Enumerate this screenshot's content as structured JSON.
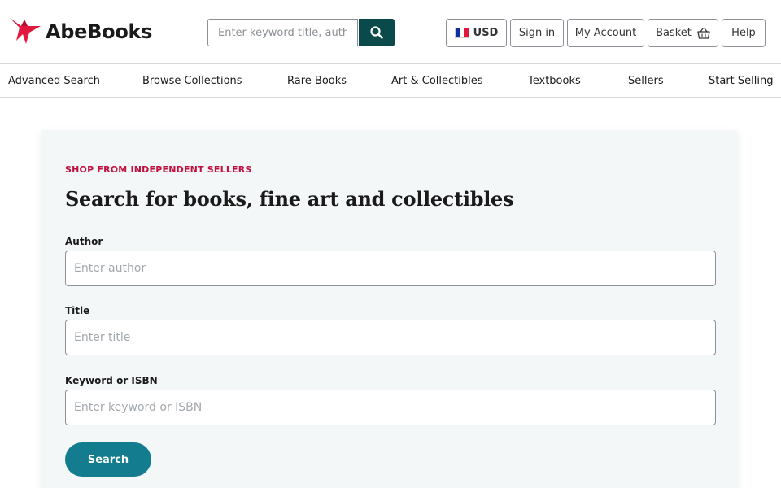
{
  "brand": {
    "name": "AbeBooks",
    "accent": "#e2173d"
  },
  "header": {
    "search_placeholder": "Enter keyword title, author",
    "search_icon": "search-icon",
    "currency": "USD",
    "currency_flag": "france-flag",
    "sign_in": "Sign in",
    "my_account": "My Account",
    "basket": "Basket",
    "basket_icon": "basket-icon",
    "help": "Help"
  },
  "nav": {
    "items": [
      {
        "label": "Advanced Search"
      },
      {
        "label": "Browse Collections"
      },
      {
        "label": "Rare Books"
      },
      {
        "label": "Art & Collectibles"
      },
      {
        "label": "Textbooks"
      },
      {
        "label": "Sellers"
      },
      {
        "label": "Start Selling"
      }
    ]
  },
  "main": {
    "eyebrow": "SHOP FROM INDEPENDENT SELLERS",
    "heading": "Search for books, fine art and collectibles",
    "fields": [
      {
        "label": "Author",
        "placeholder": "Enter author"
      },
      {
        "label": "Title",
        "placeholder": "Enter title"
      },
      {
        "label": "Keyword or ISBN",
        "placeholder": "Enter keyword or ISBN"
      }
    ],
    "submit_label": "Search"
  },
  "colors": {
    "search_button": "#0b4a4a",
    "submit_button": "#137c8f",
    "eyebrow": "#c0103f",
    "card_background": "#f3f7f8"
  }
}
